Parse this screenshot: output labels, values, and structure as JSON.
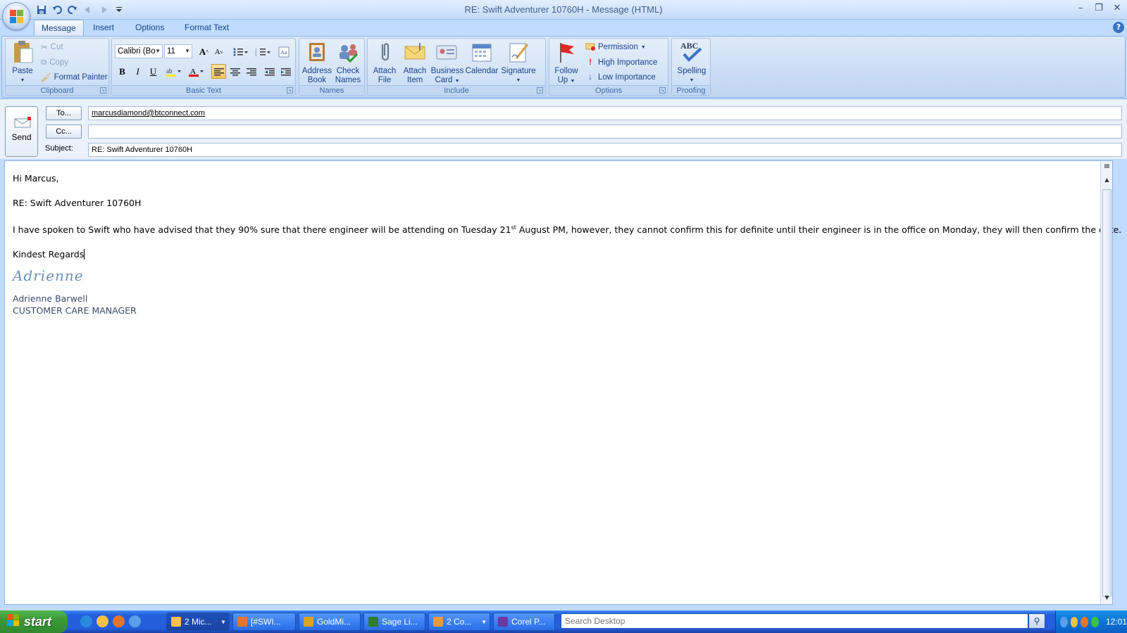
{
  "window": {
    "title": "RE: Swift Adventurer 10760H - Message (HTML)",
    "minimize": "–",
    "restore": "❐",
    "close": "✕"
  },
  "tabs": [
    "Message",
    "Insert",
    "Options",
    "Format Text"
  ],
  "help": "?",
  "ribbon": {
    "clipboard": {
      "label": "Clipboard",
      "paste": "Paste",
      "cut": "Cut",
      "copy": "Copy",
      "format_painter": "Format Painter"
    },
    "basic_text": {
      "label": "Basic Text",
      "font": "Calibri (Bo",
      "size": "11",
      "bold": "B",
      "italic": "I",
      "underline": "U"
    },
    "names": {
      "label": "Names",
      "address_book_1": "Address",
      "address_book_2": "Book",
      "check_names_1": "Check",
      "check_names_2": "Names"
    },
    "include": {
      "label": "Include",
      "attach_file_1": "Attach",
      "attach_file_2": "File",
      "attach_item_1": "Attach",
      "attach_item_2": "Item",
      "business_card_1": "Business",
      "business_card_2": "Card",
      "calendar": "Calendar",
      "signature": "Signature"
    },
    "options": {
      "label": "Options",
      "follow_up_1": "Follow",
      "follow_up_2": "Up",
      "permission": "Permission",
      "high_importance": "High Importance",
      "low_importance": "Low Importance"
    },
    "proofing": {
      "label": "Proofing",
      "spelling": "Spelling",
      "abc": "ABC"
    }
  },
  "header": {
    "send": "Send",
    "to_button": "To...",
    "cc_button": "Cc...",
    "subject_label": "Subject:",
    "to_value": "marcusdiamond@btconnect.com",
    "cc_value": "",
    "subject_value": "RE: Swift Adventurer 10760H"
  },
  "body": {
    "greeting": "Hi Marcus,",
    "re_line": "RE: Swift Adventurer 10760H",
    "para_part1": "I have spoken to Swift who have advised that they 90% sure that there engineer will be attending on Tuesday 21",
    "para_sup": "st",
    "para_part2": " August PM, however, they cannot confirm this for definite until their engineer is in the office on Monday, they will then confirm the date.",
    "closing": "Kindest Regards",
    "signature_script": "Adrienne",
    "signature_name": "Adrienne Barwell",
    "signature_title": "CUSTOMER CARE MANAGER"
  },
  "taskbar": {
    "start": "start",
    "tasks": [
      "2 Mic...",
      "[#SWI...",
      "GoldMi...",
      "Sage Li...",
      "2 Co...",
      "Corel P..."
    ],
    "search_placeholder": "Search Desktop",
    "clock": "12:01"
  },
  "colors": {
    "ribbon_bg": "#c7dbf4",
    "taskbar": "#245edb",
    "start_green": "#3c9a39",
    "text_blue": "#15428b"
  }
}
